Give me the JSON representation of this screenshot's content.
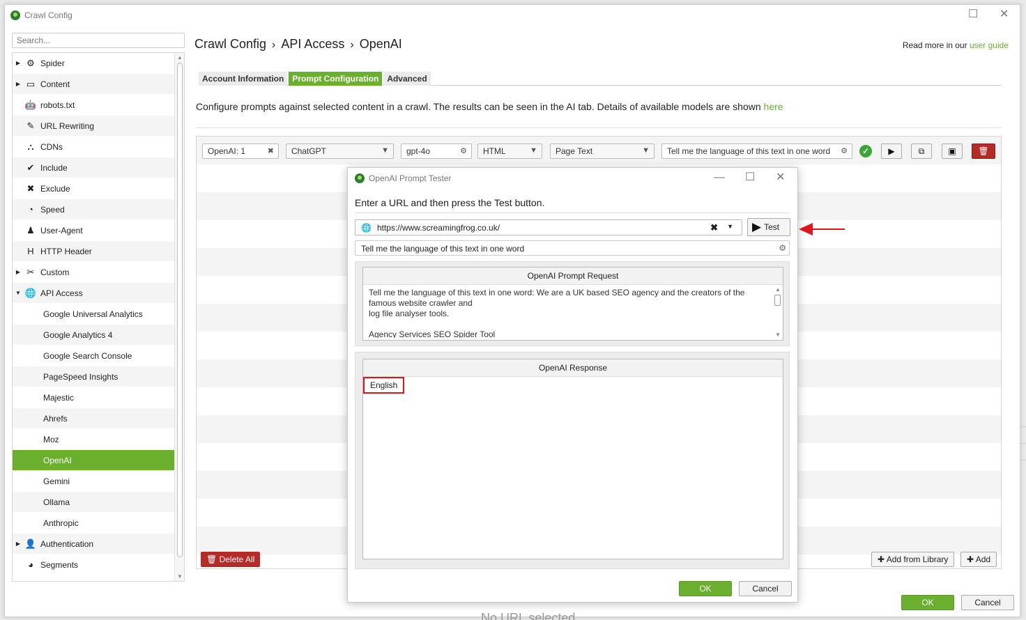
{
  "window": {
    "title": "Crawl Config"
  },
  "search": {
    "placeholder": "Search..."
  },
  "sidebar": {
    "items": [
      {
        "label": "Spider",
        "icon": "gear-icon",
        "expandable": true
      },
      {
        "label": "Content",
        "icon": "layout-icon",
        "expandable": true
      },
      {
        "label": "robots.txt",
        "icon": "robot-icon",
        "expandable": false
      },
      {
        "label": "URL Rewriting",
        "icon": "edit-icon",
        "expandable": false
      },
      {
        "label": "CDNs",
        "icon": "network-icon",
        "expandable": false
      },
      {
        "label": "Include",
        "icon": "check-circle-icon",
        "expandable": false
      },
      {
        "label": "Exclude",
        "icon": "x-circle-icon",
        "expandable": false
      },
      {
        "label": "Speed",
        "icon": "gauge-icon",
        "expandable": false
      },
      {
        "label": "User-Agent",
        "icon": "user-agent-icon",
        "expandable": false
      },
      {
        "label": "HTTP Header",
        "icon": "h-icon",
        "expandable": false
      },
      {
        "label": "Custom",
        "icon": "tools-icon",
        "expandable": true
      },
      {
        "label": "API Access",
        "icon": "globe-icon",
        "expandable": true,
        "expanded": true
      }
    ],
    "api_items": [
      "Google Universal Analytics",
      "Google Analytics 4",
      "Google Search Console",
      "PageSpeed Insights",
      "Majestic",
      "Ahrefs",
      "Moz",
      "OpenAI",
      "Gemini",
      "Ollama",
      "Anthropic"
    ],
    "selected": "OpenAI",
    "bottom_items": [
      {
        "label": "Authentication",
        "icon": "user-lock-icon",
        "expandable": true
      },
      {
        "label": "Segments",
        "icon": "pie-icon",
        "expandable": false
      }
    ]
  },
  "breadcrumb": {
    "part1": "Crawl Config",
    "part2": "API Access",
    "part3": "OpenAI",
    "sep": "›"
  },
  "guide": {
    "prefix": "Read more in our",
    "link": "user guide"
  },
  "tabs": [
    {
      "label": "Account Information",
      "active": false
    },
    {
      "label": "Prompt Configuration",
      "active": true
    },
    {
      "label": "Advanced",
      "active": false
    }
  ],
  "description": {
    "text": "Configure prompts against selected content in a crawl. The results can be seen in the AI tab. Details of available models are shown",
    "link": "here"
  },
  "prompt_row": {
    "name": "OpenAI: 1",
    "provider": "ChatGPT",
    "model": "gpt-4o",
    "content_type": "HTML",
    "content": "Page Text",
    "prompt": "Tell me the language of this text in one word"
  },
  "panel_buttons": {
    "delete_all": "Delete All",
    "add_from_library": "Add from Library",
    "add": "Add"
  },
  "footer": {
    "ok": "OK",
    "cancel": "Cancel"
  },
  "behind_text": "No URL selected",
  "dialog": {
    "title": "OpenAI Prompt Tester",
    "instruction": "Enter a URL and then press the Test button.",
    "url": "https://www.screamingfrog.co.uk/",
    "test_label": "Test",
    "prompt": "Tell me the language of this text in one word",
    "request_header": "OpenAI Prompt Request",
    "request_lines": [
      "Tell me the language of this text in one word: We are a UK based SEO agency and the creators of the",
      "famous website crawler and",
      "log file analyser tools.",
      "",
      "Agency Services SEO Spider Tool"
    ],
    "response_header": "OpenAI Response",
    "response": "English",
    "ok": "OK",
    "cancel": "Cancel"
  },
  "colors": {
    "accent": "#6aaf2e",
    "danger": "#b52b27",
    "highlight": "#e0161d"
  }
}
